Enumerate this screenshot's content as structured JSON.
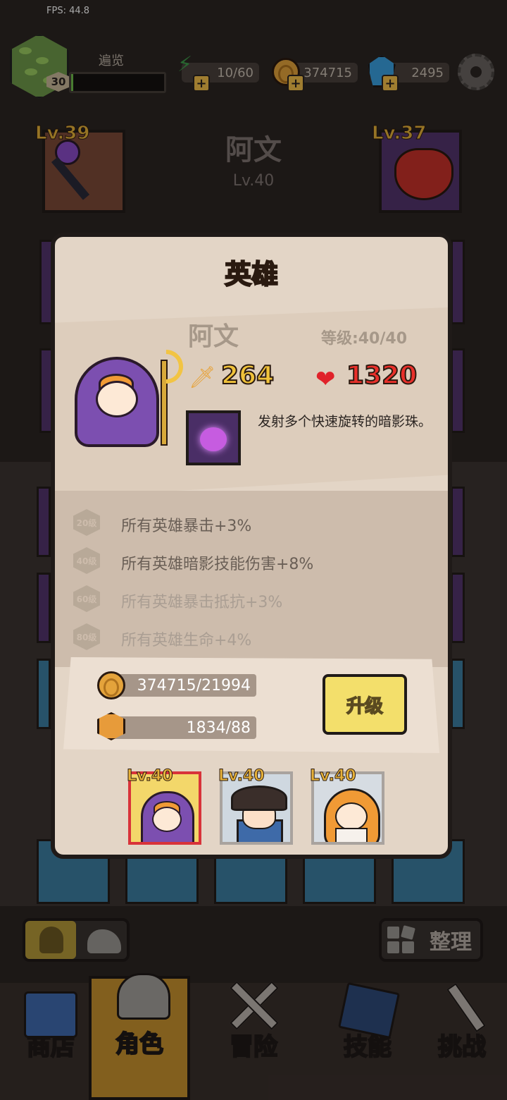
{
  "fps": "FPS: 44.8",
  "player": {
    "name": "遍览",
    "level": "30",
    "xp_progress": 0.02
  },
  "resources": {
    "energy": {
      "icon": "lightning-icon",
      "value": "10/60",
      "color": "#3e9a4a"
    },
    "gold": {
      "icon": "coin-icon",
      "value": "374715",
      "color": "#e4a33b"
    },
    "gems": {
      "icon": "gem-icon",
      "value": "2495",
      "color": "#3aa0e0"
    }
  },
  "background_hero": {
    "name": "阿文",
    "level": "Lv.40",
    "left_equipment_level": "Lv.39",
    "right_equipment_level": "Lv.37"
  },
  "modal": {
    "title": "英雄",
    "hero_name": "阿文",
    "hero_level": "等级:40/40",
    "attack": "264",
    "hp": "1320",
    "skill_description": "发射多个快速旋转的暗影珠。",
    "bonuses": [
      {
        "badge": "20级",
        "text": "所有英雄暴击+3%",
        "active": true
      },
      {
        "badge": "40级",
        "text": "所有英雄暗影技能伤害+8%",
        "active": true
      },
      {
        "badge": "60级",
        "text": "所有英雄暴击抵抗+3%",
        "active": false
      },
      {
        "badge": "80级",
        "text": "所有英雄生命+4%",
        "active": false
      }
    ],
    "costs": {
      "gold": "374715/21994",
      "medal": "1834/88"
    },
    "upgrade_label": "升级",
    "hero_cards": [
      {
        "level": "Lv.40",
        "hero": "mage",
        "selected": true
      },
      {
        "level": "Lv.40",
        "hero": "pirate",
        "selected": false
      },
      {
        "level": "Lv.40",
        "hero": "priestess",
        "selected": false
      }
    ]
  },
  "controls": {
    "sort_label": "整理"
  },
  "nav": {
    "items": [
      {
        "label": "商店",
        "icon": "shop-icon",
        "active": false
      },
      {
        "label": "角色",
        "icon": "helmet-icon",
        "active": true
      },
      {
        "label": "冒险",
        "icon": "crossed-swords-icon",
        "active": false
      },
      {
        "label": "技能",
        "icon": "spellbook-icon",
        "active": false
      },
      {
        "label": "挑战",
        "icon": "challenge-sword-icon",
        "active": false
      }
    ]
  },
  "colors": {
    "modal_bg": "#e3d5c6",
    "title_orange": "#f0a623",
    "attack_yellow": "#f0c23a",
    "hp_red": "#e8302a",
    "upgrade_yellow": "#f3df6b",
    "nav_active": "#c8922e"
  }
}
